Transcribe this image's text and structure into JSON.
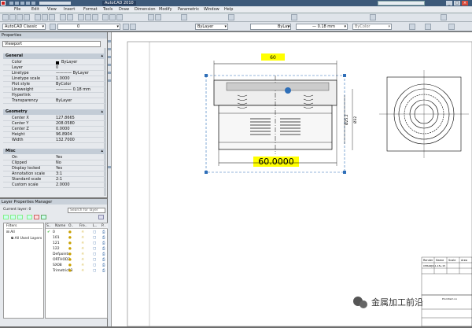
{
  "app": {
    "title": "AutoCAD 2010"
  },
  "menu": [
    "File",
    "Edit",
    "View",
    "Insert",
    "Format",
    "Tools",
    "Draw",
    "Dimension",
    "Modify",
    "Parametric",
    "Window",
    "Help"
  ],
  "toolbar": {
    "workspace": "AutoCAD Classic",
    "layer_combo": "0",
    "color_combo": "ByLayer",
    "linetype_combo": "ByLayer",
    "lineweight_combo": "— 0.18 mm",
    "plotstyle_combo": "ByColor"
  },
  "properties": {
    "title": "Properties",
    "selected": "Viewport",
    "sections": [
      {
        "name": "General",
        "rows": [
          [
            "Color",
            "ByLayer"
          ],
          [
            "Layer",
            "0"
          ],
          [
            "Linetype",
            "———— ByLayer"
          ],
          [
            "Linetype scale",
            "1.0000"
          ],
          [
            "Plot style",
            "ByColor"
          ],
          [
            "Lineweight",
            "———— 0.18 mm"
          ],
          [
            "Hyperlink",
            ""
          ],
          [
            "Transparency",
            "ByLayer"
          ]
        ]
      },
      {
        "name": "Geometry",
        "rows": [
          [
            "Center X",
            "127.8665"
          ],
          [
            "Center Y",
            "208.0580"
          ],
          [
            "Center Z",
            "0.0000"
          ],
          [
            "Height",
            "96.8904"
          ],
          [
            "Width",
            "132.7000"
          ]
        ]
      },
      {
        "name": "Misc",
        "rows": [
          [
            "On",
            "Yes"
          ],
          [
            "Clipped",
            "No"
          ],
          [
            "Display locked",
            "Yes"
          ],
          [
            "Annotation scale",
            "3:1"
          ],
          [
            "Standard scale",
            "2:1"
          ],
          [
            "Custom scale",
            "2.0000"
          ]
        ]
      }
    ]
  },
  "layers": {
    "title": "Layer Properties Manager",
    "current": "Current layer: 0",
    "search_placeholder": "Search for layer",
    "filters_header": "Filters",
    "filter_all": "All",
    "filter_used": "All Used Layers",
    "columns": [
      "S..",
      "Name",
      "O..",
      "Fre..",
      "L..",
      "P.."
    ],
    "rows": [
      "0",
      "101",
      "121",
      "122",
      "Defpoints",
      "ORTHOD2",
      "SX08",
      "Trimetric03"
    ]
  },
  "drawing": {
    "dim_top": "60",
    "dim_bottom": "60.0000",
    "dim_v1": "Ø25.2",
    "dim_v2": "Ø32",
    "tb_headers": [
      "Render",
      "Name",
      "Scale",
      "Area"
    ],
    "tb_code": "CMS4ZJQ.1-15ε-15",
    "tb_note": "Prod.Item no",
    "watermark": "金属加工前沿"
  },
  "colors": {
    "highlight": "#ffff00",
    "accent": "#2f6fb8"
  }
}
